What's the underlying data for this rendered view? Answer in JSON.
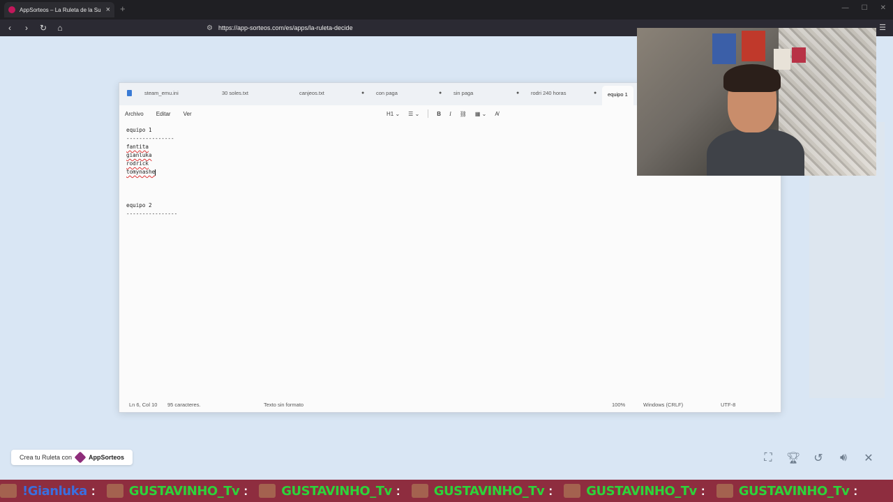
{
  "browser": {
    "tab_title": "AppSorteos – La Ruleta de la Su",
    "new_tab": "+",
    "url": "https://app-sorteos.com/es/apps/la-ruleta-decide"
  },
  "notepad": {
    "tabs": [
      "steam_emu.ini",
      "30 soles.txt",
      "canjeos.txt",
      "con paga",
      "sin paga",
      "rodri 240 horas",
      "equipo 1"
    ],
    "menu": [
      "Archivo",
      "Editar",
      "Ver"
    ],
    "toolbar": {
      "heading": "H1",
      "bold": "B",
      "italic": "I"
    },
    "content": {
      "team1_title": "equipo 1",
      "team1_sep": "---------------",
      "team1_members": [
        "fantita",
        "gianluka",
        "rodrick",
        "tomynashe"
      ],
      "team2_title": "equipo 2",
      "team2_sep": "----------------"
    },
    "status": {
      "position": "Ln 6, Col 10",
      "chars": "95 caracteres.",
      "format": "Texto sin formato",
      "zoom": "100%",
      "eol": "Windows (CRLF)",
      "encoding": "UTF-8"
    }
  },
  "promo": {
    "text": "Crea tu Ruleta con",
    "brand": "AppSorteos"
  },
  "ticker": {
    "items": [
      {
        "name": "!Gianluka",
        "color": "blue"
      },
      {
        "name": "GUSTAVINHO_Tv",
        "color": "green"
      },
      {
        "name": "GUSTAVINHO_Tv",
        "color": "green"
      },
      {
        "name": "GUSTAVINHO_Tv",
        "color": "green"
      },
      {
        "name": "GUSTAVINHO_Tv",
        "color": "green"
      },
      {
        "name": "GUSTAVINHO_Tv",
        "color": "green"
      }
    ],
    "colon": ":"
  }
}
